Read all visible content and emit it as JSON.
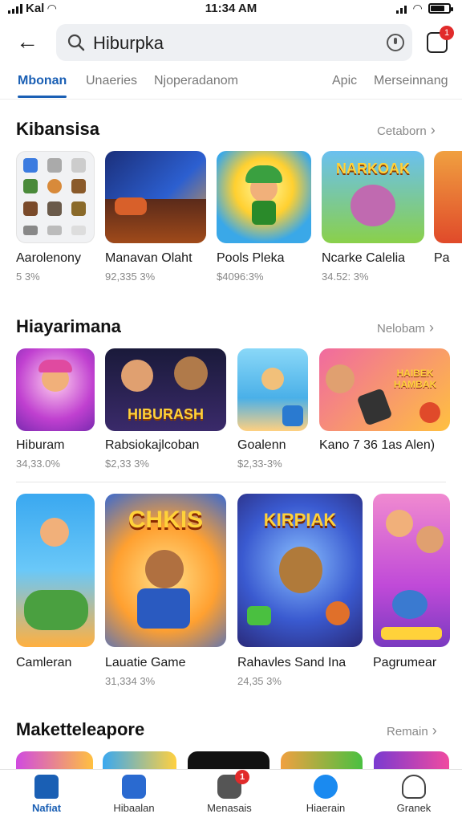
{
  "status_bar": {
    "carrier": "Kal",
    "time": "11:34 AM"
  },
  "search": {
    "query": "Hiburpka",
    "cart_badge": "1"
  },
  "tabs": [
    {
      "label": "Mbonan",
      "active": true
    },
    {
      "label": "Unaeries",
      "active": false
    },
    {
      "label": "Njoperadanom",
      "active": false
    },
    {
      "label": "Apic",
      "active": false
    },
    {
      "label": "Merseinnang",
      "active": false
    }
  ],
  "section1": {
    "title": "Kibansisa",
    "see_all": "Cetaborn",
    "items": [
      {
        "name": "Aarolenony",
        "meta": "5 3%",
        "art": ""
      },
      {
        "name": "Manavan Olaht",
        "meta": "92,335 3%",
        "art": ""
      },
      {
        "name": "Pools Pleka",
        "meta": "$4096:3%",
        "art": ""
      },
      {
        "name": "Ncarke Calelia",
        "meta": "34.52: 3%",
        "art": "NARKOAK"
      },
      {
        "name": "Pa",
        "meta": "",
        "art": ""
      }
    ]
  },
  "section2": {
    "title": "Hiayarimana",
    "see_all": "Nelobam",
    "items": [
      {
        "name": "Hiburam",
        "meta": "34,33.0%",
        "art": ""
      },
      {
        "name": "Rabsiokajlcoban",
        "meta": "$2,33 3%",
        "art": "HIBURASH"
      },
      {
        "name": "Goalenn",
        "meta": "$2,33-3%",
        "art": ""
      },
      {
        "name": "Kano 7 36 1as Alen)",
        "meta": "",
        "art": "HAIBEK HAMBAK"
      }
    ]
  },
  "section3": {
    "items": [
      {
        "name": "Camleran",
        "meta": "",
        "art": ""
      },
      {
        "name": "Lauatie Game",
        "meta": "31,334 3%",
        "art": "CHKIS"
      },
      {
        "name": "Rahavles Sand Ina",
        "meta": "24,35 3%",
        "art": "KIRPIAK"
      },
      {
        "name": "Pagrumear",
        "meta": "",
        "art": ""
      }
    ]
  },
  "section4": {
    "title": "Maketteleapore",
    "see_all": "Remain"
  },
  "bottom_nav": [
    {
      "label": "Nafiat",
      "active": true,
      "badge": ""
    },
    {
      "label": "Hibaalan",
      "active": false,
      "badge": ""
    },
    {
      "label": "Menasais",
      "active": false,
      "badge": "1"
    },
    {
      "label": "Hiaerain",
      "active": false,
      "badge": ""
    },
    {
      "label": "Granek",
      "active": false,
      "badge": ""
    }
  ]
}
